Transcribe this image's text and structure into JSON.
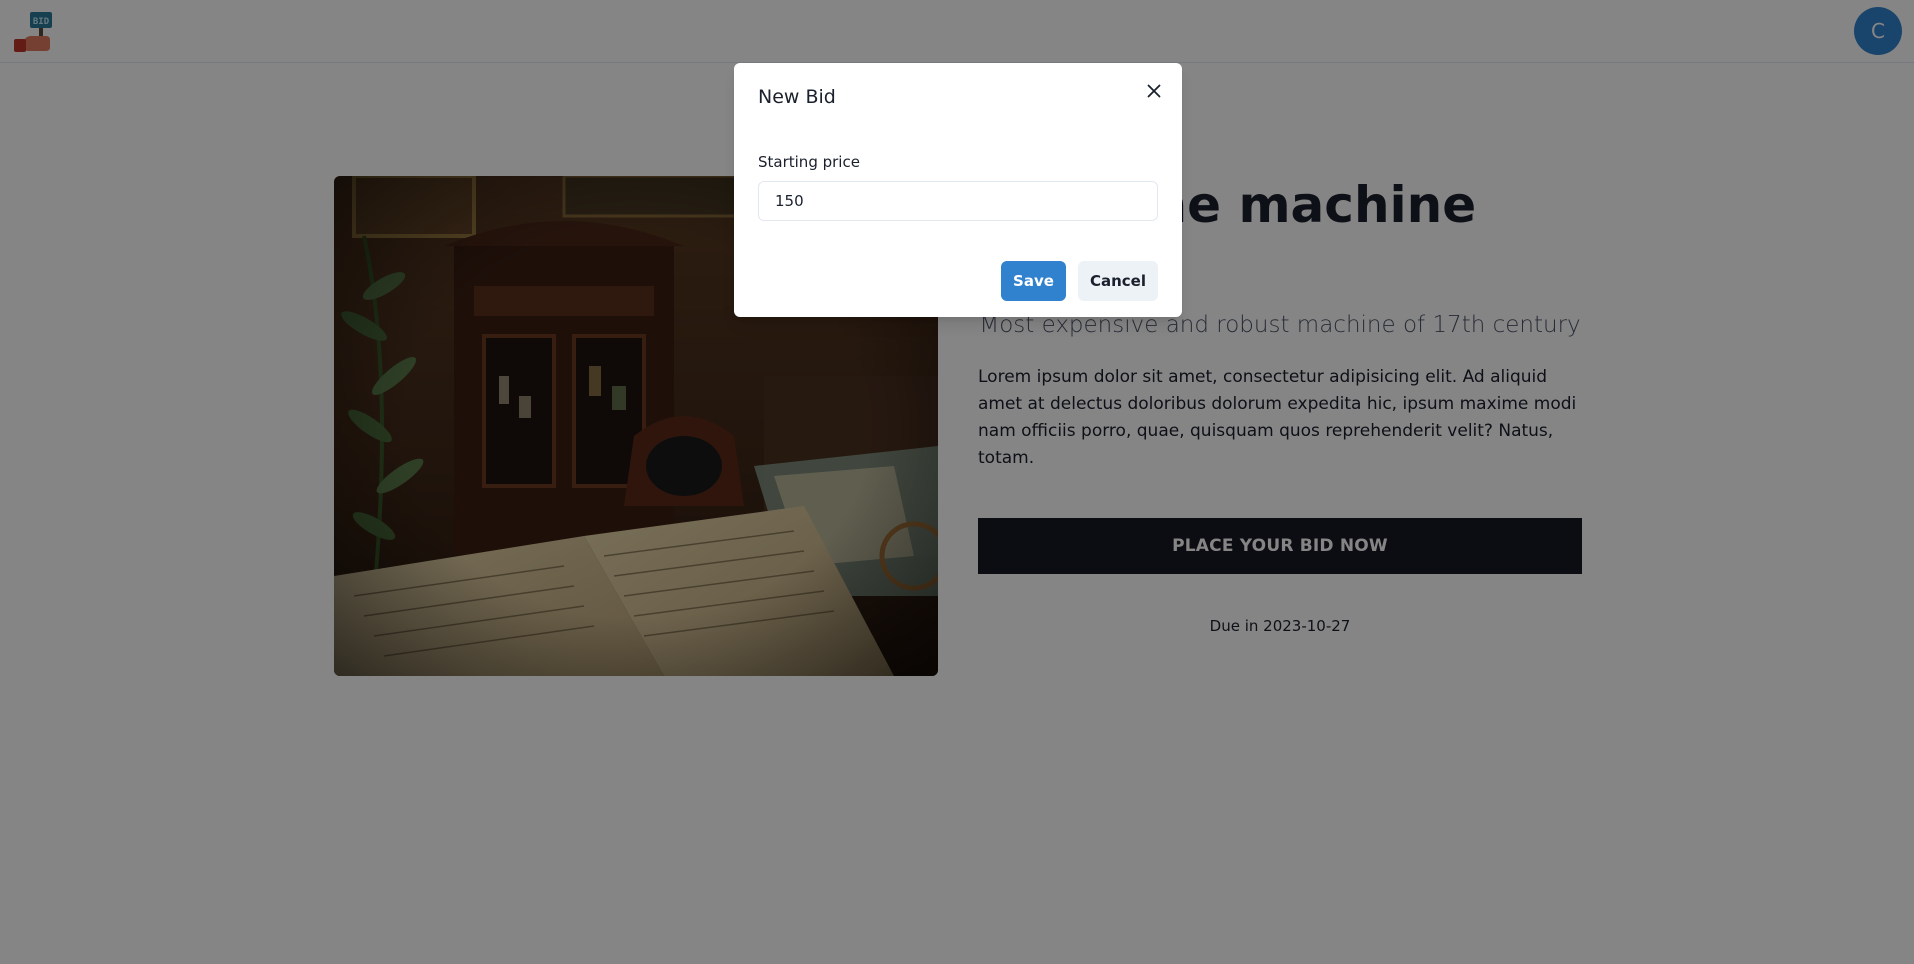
{
  "header": {
    "logo_text": "BID",
    "avatar_initial": "C"
  },
  "item": {
    "title": "Time machine",
    "subtitle": "Most expensive and robust machine of 17th century",
    "description": "Lorem ipsum dolor sit amet, consectetur adipisicing elit. Ad aliquid amet at delectus doloribus dolorum expedita hic, ipsum maxime modi nam officiis porro, quae, quisquam quos reprehenderit velit? Natus, totam.",
    "bid_button_label": "PLACE YOUR BID NOW",
    "due_text": "Due in 2023-10-27"
  },
  "modal": {
    "title": "New Bid",
    "field_label": "Starting price",
    "price_value": "150",
    "save_label": "Save",
    "cancel_label": "Cancel"
  },
  "icons": {
    "close": "close-icon",
    "logo": "bid-logo-icon"
  },
  "colors": {
    "accent": "#3182ce",
    "bid_button_bg": "#171923",
    "overlay": "rgba(0,0,0,0.48)"
  }
}
